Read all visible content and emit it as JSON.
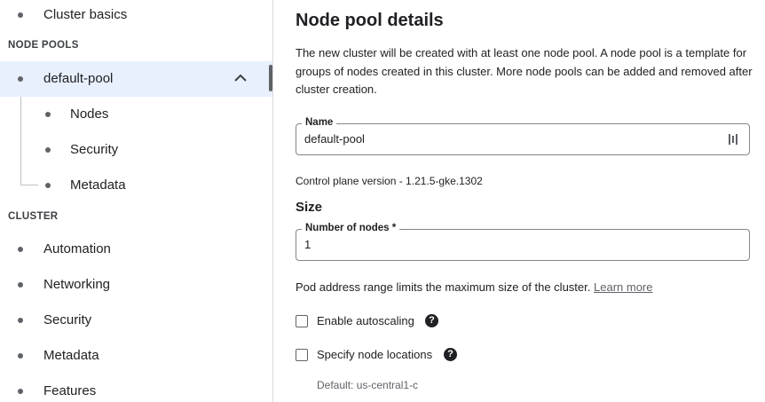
{
  "sidebar": {
    "top_item": "Cluster basics",
    "node_pools_header": "NODE POOLS",
    "pool": {
      "label": "default-pool",
      "expanded": true
    },
    "pool_children": [
      "Nodes",
      "Security",
      "Metadata"
    ],
    "cluster_header": "CLUSTER",
    "cluster_items": [
      "Automation",
      "Networking",
      "Security",
      "Metadata",
      "Features"
    ]
  },
  "main": {
    "title": "Node pool details",
    "description": "The new cluster will be created with at least one node pool. A node pool is a template for groups of nodes created in this cluster. More node pools can be added and removed after cluster creation.",
    "name_field": {
      "label": "Name",
      "value": "default-pool"
    },
    "control_plane_version": "Control plane version - 1.21.5-gke.1302",
    "size_heading": "Size",
    "nodes_field": {
      "label": "Number of nodes *",
      "value": "1"
    },
    "pod_range_text": "Pod address range limits the maximum size of the cluster.",
    "learn_more": "Learn more",
    "enable_autoscaling": {
      "label": "Enable autoscaling",
      "checked": false
    },
    "specify_locations": {
      "label": "Specify node locations",
      "checked": false
    },
    "default_location": "Default: us-central1-c",
    "help_glyph": "?"
  },
  "colors": {
    "selected_bg": "#e8f0fe",
    "text": "#202124",
    "muted": "#5f6368",
    "border": "#80868b"
  },
  "icons": {
    "chevron": "chevron-up-icon",
    "field_icon": "text-cursor-icon",
    "help": "help-circle-icon"
  }
}
